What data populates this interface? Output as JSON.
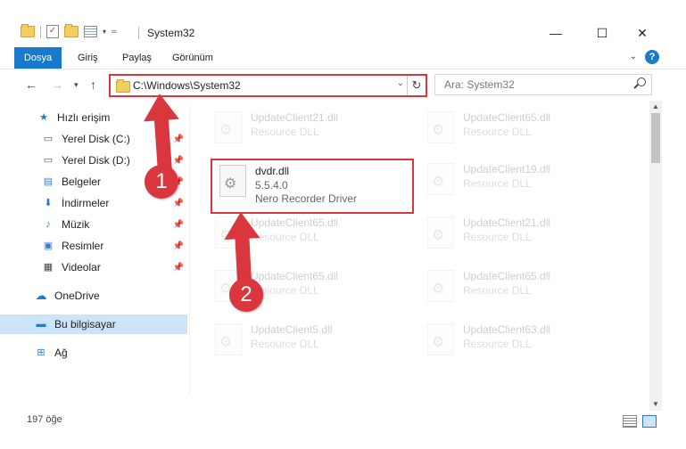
{
  "window": {
    "title": "System32",
    "minimize": "—",
    "maximize": "☐",
    "close": "✕"
  },
  "ribbon": {
    "tabs": [
      "Dosya",
      "Giriş",
      "Paylaş",
      "Görünüm"
    ],
    "help": "?"
  },
  "address": {
    "path": "C:\\Windows\\System32",
    "refresh": "↻"
  },
  "search": {
    "placeholder": "Ara: System32"
  },
  "sidebar": {
    "items": [
      {
        "label": "Hızlı erişim",
        "icon": "star-icon",
        "pinned": false
      },
      {
        "label": "Yerel Disk (C:)",
        "icon": "drive-icon",
        "pinned": true
      },
      {
        "label": "Yerel Disk (D:)",
        "icon": "drive-icon",
        "pinned": true
      },
      {
        "label": "Belgeler",
        "icon": "document-icon",
        "pinned": true
      },
      {
        "label": "İndirmeler",
        "icon": "download-icon",
        "pinned": true
      },
      {
        "label": "Müzik",
        "icon": "music-icon",
        "pinned": true
      },
      {
        "label": "Resimler",
        "icon": "pictures-icon",
        "pinned": true
      },
      {
        "label": "Videolar",
        "icon": "video-icon",
        "pinned": true
      },
      {
        "label": "OneDrive",
        "icon": "cloud-icon",
        "pinned": false
      },
      {
        "label": "Bu bilgisayar",
        "icon": "computer-icon",
        "pinned": false
      },
      {
        "label": "Ağ",
        "icon": "network-icon",
        "pinned": false
      }
    ]
  },
  "files": {
    "highlighted": {
      "name": "dvdr.dll",
      "version": "5.5.4.0",
      "description": "Nero Recorder Driver"
    },
    "faded": [
      {
        "name": "UpdateClient21.dll",
        "desc": "Resource DLL"
      },
      {
        "name": "UpdateClient65.dll",
        "desc": "Resource DLL"
      },
      {
        "name": "UpdateClient19.dll",
        "desc": "Resource DLL"
      },
      {
        "name": "UpdateClient65.dll",
        "desc": "Resource DLL"
      },
      {
        "name": "UpdateClient21.dll",
        "desc": "Resource DLL"
      },
      {
        "name": "UpdateClient65.dll",
        "desc": "Resource DLL"
      },
      {
        "name": "UpdateClient65.dll",
        "desc": "Resource DLL"
      },
      {
        "name": "UpdateClient5.dll",
        "desc": "Resource DLL"
      },
      {
        "name": "UpdateClient63.dll",
        "desc": "Resource DLL"
      }
    ]
  },
  "status": {
    "count": "197 öğe"
  },
  "annotations": {
    "badge1": "1",
    "badge2": "2",
    "color": "#d9363e"
  }
}
